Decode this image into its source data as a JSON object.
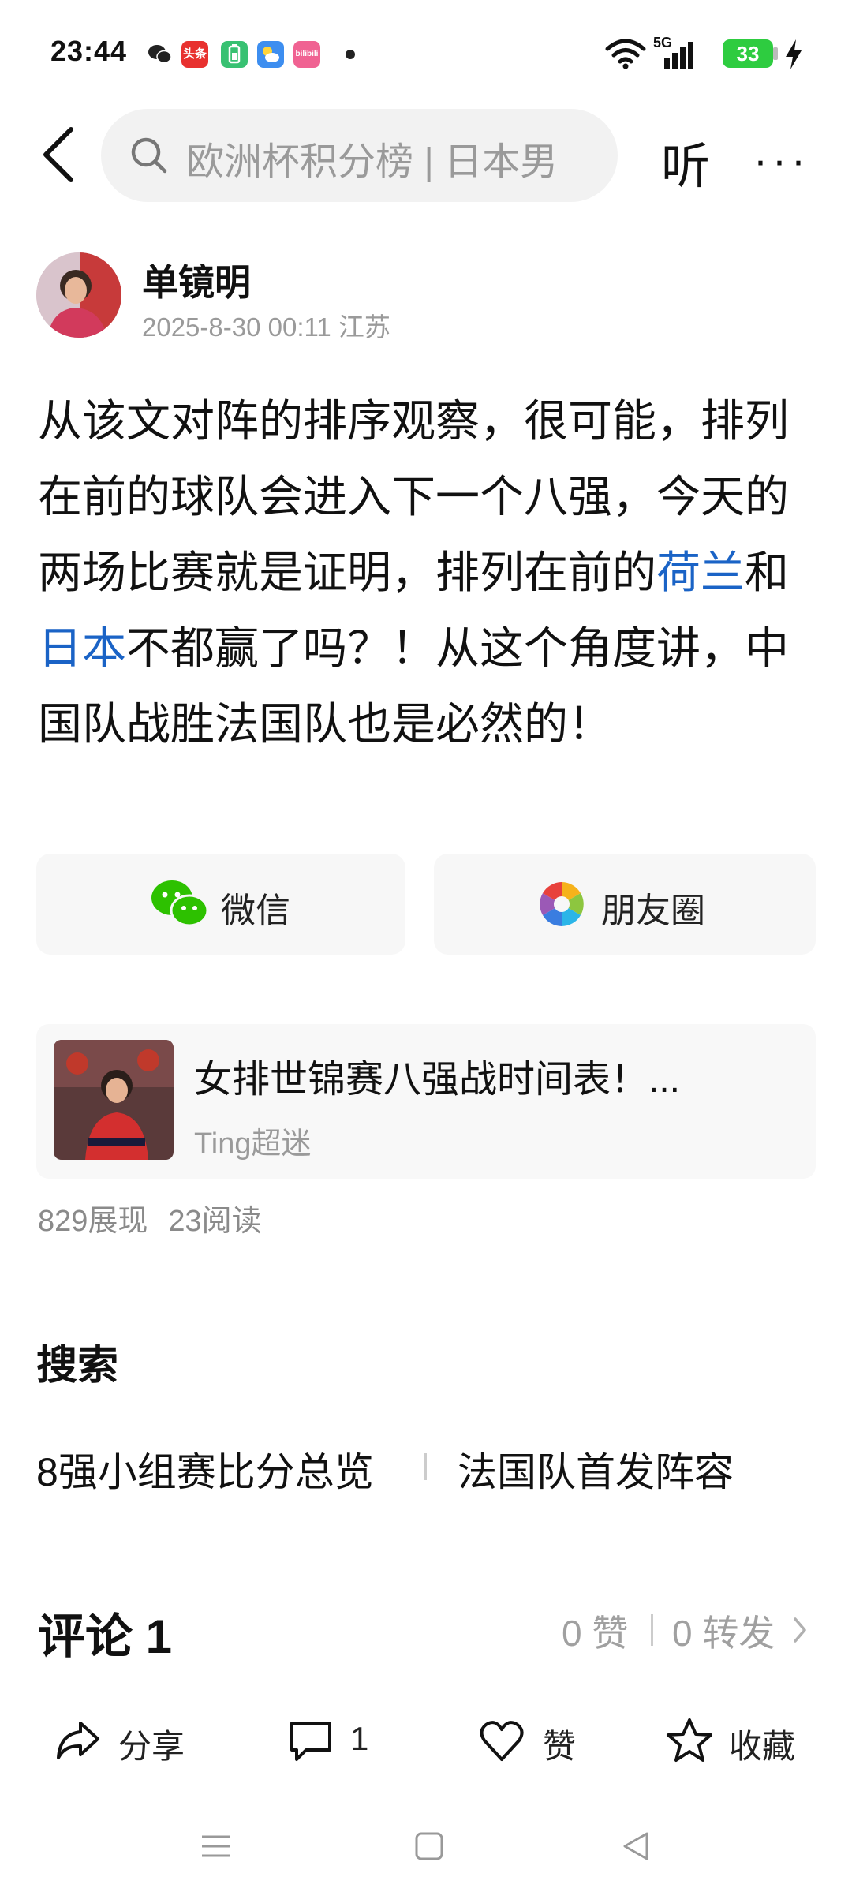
{
  "status_bar": {
    "time": "23:44",
    "network": "5G",
    "battery": "33",
    "app_icons": [
      "wechat-icon",
      "toutiao-icon",
      "battery-app-icon",
      "weather-icon",
      "bilibili-icon"
    ],
    "app_icon_text": {
      "toutiao": "头条",
      "bilibili": "bilibili"
    }
  },
  "nav": {
    "search_placeholder": "欧洲杯积分榜 | 日本男",
    "listen_label": "听",
    "more_label": "···"
  },
  "author": {
    "name": "单镜明",
    "meta": "2025-8-30 00:11 江苏"
  },
  "post": {
    "text_before": "从该文对阵的排序观察，很可能，排列在前的球队会进入下一个八强，今天的两场比赛就是证明，排列在前的",
    "link1": "荷兰",
    "text_mid": "和",
    "link2": "日本",
    "text_after": "不都赢了吗？！从这个角度讲，中国队战胜法国队也是必然的！"
  },
  "share": {
    "wechat_label": "微信",
    "moments_label": "朋友圈"
  },
  "linked_article": {
    "title": "女排世锦赛八强战时间表！...",
    "source": "Ting超迷"
  },
  "stats": {
    "views": "829展现",
    "reads": "23阅读"
  },
  "search_section": {
    "heading": "搜索",
    "chips": [
      "8强小组赛比分总览",
      "法国队首发阵容"
    ]
  },
  "comments": {
    "heading": "评论 1",
    "likes": "0 赞",
    "forwards": "0 转发"
  },
  "action_bar": {
    "share_label": "分享",
    "comment_count": "1",
    "like_label": "赞",
    "favorite_label": "收藏"
  },
  "colors": {
    "link": "#1a63c6",
    "battery": "#2ecc40",
    "wechat_green": "#2dc100"
  }
}
